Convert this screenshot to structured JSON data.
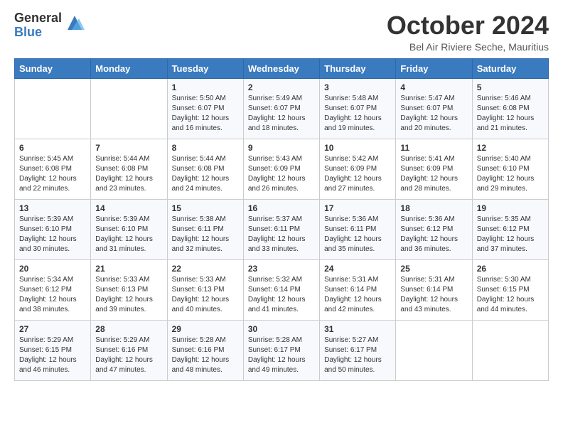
{
  "logo": {
    "general": "General",
    "blue": "Blue"
  },
  "title": "October 2024",
  "subtitle": "Bel Air Riviere Seche, Mauritius",
  "days": [
    "Sunday",
    "Monday",
    "Tuesday",
    "Wednesday",
    "Thursday",
    "Friday",
    "Saturday"
  ],
  "weeks": [
    [
      {
        "num": "",
        "sunrise": "",
        "sunset": "",
        "daylight": ""
      },
      {
        "num": "",
        "sunrise": "",
        "sunset": "",
        "daylight": ""
      },
      {
        "num": "1",
        "sunrise": "Sunrise: 5:50 AM",
        "sunset": "Sunset: 6:07 PM",
        "daylight": "Daylight: 12 hours and 16 minutes."
      },
      {
        "num": "2",
        "sunrise": "Sunrise: 5:49 AM",
        "sunset": "Sunset: 6:07 PM",
        "daylight": "Daylight: 12 hours and 18 minutes."
      },
      {
        "num": "3",
        "sunrise": "Sunrise: 5:48 AM",
        "sunset": "Sunset: 6:07 PM",
        "daylight": "Daylight: 12 hours and 19 minutes."
      },
      {
        "num": "4",
        "sunrise": "Sunrise: 5:47 AM",
        "sunset": "Sunset: 6:07 PM",
        "daylight": "Daylight: 12 hours and 20 minutes."
      },
      {
        "num": "5",
        "sunrise": "Sunrise: 5:46 AM",
        "sunset": "Sunset: 6:08 PM",
        "daylight": "Daylight: 12 hours and 21 minutes."
      }
    ],
    [
      {
        "num": "6",
        "sunrise": "Sunrise: 5:45 AM",
        "sunset": "Sunset: 6:08 PM",
        "daylight": "Daylight: 12 hours and 22 minutes."
      },
      {
        "num": "7",
        "sunrise": "Sunrise: 5:44 AM",
        "sunset": "Sunset: 6:08 PM",
        "daylight": "Daylight: 12 hours and 23 minutes."
      },
      {
        "num": "8",
        "sunrise": "Sunrise: 5:44 AM",
        "sunset": "Sunset: 6:08 PM",
        "daylight": "Daylight: 12 hours and 24 minutes."
      },
      {
        "num": "9",
        "sunrise": "Sunrise: 5:43 AM",
        "sunset": "Sunset: 6:09 PM",
        "daylight": "Daylight: 12 hours and 26 minutes."
      },
      {
        "num": "10",
        "sunrise": "Sunrise: 5:42 AM",
        "sunset": "Sunset: 6:09 PM",
        "daylight": "Daylight: 12 hours and 27 minutes."
      },
      {
        "num": "11",
        "sunrise": "Sunrise: 5:41 AM",
        "sunset": "Sunset: 6:09 PM",
        "daylight": "Daylight: 12 hours and 28 minutes."
      },
      {
        "num": "12",
        "sunrise": "Sunrise: 5:40 AM",
        "sunset": "Sunset: 6:10 PM",
        "daylight": "Daylight: 12 hours and 29 minutes."
      }
    ],
    [
      {
        "num": "13",
        "sunrise": "Sunrise: 5:39 AM",
        "sunset": "Sunset: 6:10 PM",
        "daylight": "Daylight: 12 hours and 30 minutes."
      },
      {
        "num": "14",
        "sunrise": "Sunrise: 5:39 AM",
        "sunset": "Sunset: 6:10 PM",
        "daylight": "Daylight: 12 hours and 31 minutes."
      },
      {
        "num": "15",
        "sunrise": "Sunrise: 5:38 AM",
        "sunset": "Sunset: 6:11 PM",
        "daylight": "Daylight: 12 hours and 32 minutes."
      },
      {
        "num": "16",
        "sunrise": "Sunrise: 5:37 AM",
        "sunset": "Sunset: 6:11 PM",
        "daylight": "Daylight: 12 hours and 33 minutes."
      },
      {
        "num": "17",
        "sunrise": "Sunrise: 5:36 AM",
        "sunset": "Sunset: 6:11 PM",
        "daylight": "Daylight: 12 hours and 35 minutes."
      },
      {
        "num": "18",
        "sunrise": "Sunrise: 5:36 AM",
        "sunset": "Sunset: 6:12 PM",
        "daylight": "Daylight: 12 hours and 36 minutes."
      },
      {
        "num": "19",
        "sunrise": "Sunrise: 5:35 AM",
        "sunset": "Sunset: 6:12 PM",
        "daylight": "Daylight: 12 hours and 37 minutes."
      }
    ],
    [
      {
        "num": "20",
        "sunrise": "Sunrise: 5:34 AM",
        "sunset": "Sunset: 6:12 PM",
        "daylight": "Daylight: 12 hours and 38 minutes."
      },
      {
        "num": "21",
        "sunrise": "Sunrise: 5:33 AM",
        "sunset": "Sunset: 6:13 PM",
        "daylight": "Daylight: 12 hours and 39 minutes."
      },
      {
        "num": "22",
        "sunrise": "Sunrise: 5:33 AM",
        "sunset": "Sunset: 6:13 PM",
        "daylight": "Daylight: 12 hours and 40 minutes."
      },
      {
        "num": "23",
        "sunrise": "Sunrise: 5:32 AM",
        "sunset": "Sunset: 6:14 PM",
        "daylight": "Daylight: 12 hours and 41 minutes."
      },
      {
        "num": "24",
        "sunrise": "Sunrise: 5:31 AM",
        "sunset": "Sunset: 6:14 PM",
        "daylight": "Daylight: 12 hours and 42 minutes."
      },
      {
        "num": "25",
        "sunrise": "Sunrise: 5:31 AM",
        "sunset": "Sunset: 6:14 PM",
        "daylight": "Daylight: 12 hours and 43 minutes."
      },
      {
        "num": "26",
        "sunrise": "Sunrise: 5:30 AM",
        "sunset": "Sunset: 6:15 PM",
        "daylight": "Daylight: 12 hours and 44 minutes."
      }
    ],
    [
      {
        "num": "27",
        "sunrise": "Sunrise: 5:29 AM",
        "sunset": "Sunset: 6:15 PM",
        "daylight": "Daylight: 12 hours and 46 minutes."
      },
      {
        "num": "28",
        "sunrise": "Sunrise: 5:29 AM",
        "sunset": "Sunset: 6:16 PM",
        "daylight": "Daylight: 12 hours and 47 minutes."
      },
      {
        "num": "29",
        "sunrise": "Sunrise: 5:28 AM",
        "sunset": "Sunset: 6:16 PM",
        "daylight": "Daylight: 12 hours and 48 minutes."
      },
      {
        "num": "30",
        "sunrise": "Sunrise: 5:28 AM",
        "sunset": "Sunset: 6:17 PM",
        "daylight": "Daylight: 12 hours and 49 minutes."
      },
      {
        "num": "31",
        "sunrise": "Sunrise: 5:27 AM",
        "sunset": "Sunset: 6:17 PM",
        "daylight": "Daylight: 12 hours and 50 minutes."
      },
      {
        "num": "",
        "sunrise": "",
        "sunset": "",
        "daylight": ""
      },
      {
        "num": "",
        "sunrise": "",
        "sunset": "",
        "daylight": ""
      }
    ]
  ]
}
